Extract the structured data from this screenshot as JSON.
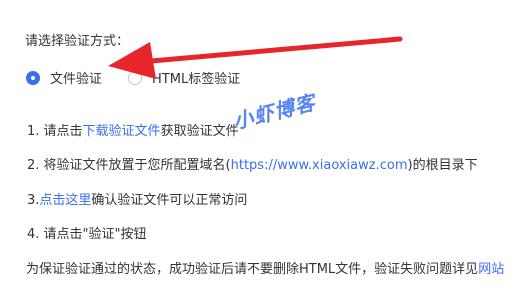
{
  "section": {
    "title": "请选择验证方式："
  },
  "radio": {
    "options": [
      {
        "label": "文件验证",
        "checked": true
      },
      {
        "label": "HTML标签验证",
        "checked": false
      }
    ]
  },
  "steps": {
    "step1": {
      "prefix": "1. 请点击",
      "link": "下载验证文件",
      "suffix": "获取验证文件"
    },
    "step2": {
      "prefix": "2. 将验证文件放置于您所配置域名(",
      "link": "https://www.xiaoxiawz.com",
      "suffix": ")的根目录下"
    },
    "step3": {
      "prefix": "3.",
      "link": "点击这里",
      "suffix": "确认验证文件可以正常访问"
    },
    "step4": {
      "text": "4. 请点击\"验证\"按钮"
    }
  },
  "notice": {
    "text": "为保证验证通过的状态，成功验证后请不要删除HTML文件，验证失败问题详见",
    "link": "网站"
  },
  "watermark": {
    "text": "小虾博客"
  },
  "colors": {
    "accent": "#3a6ff2",
    "arrow": "#e8252a",
    "text": "#333333"
  }
}
